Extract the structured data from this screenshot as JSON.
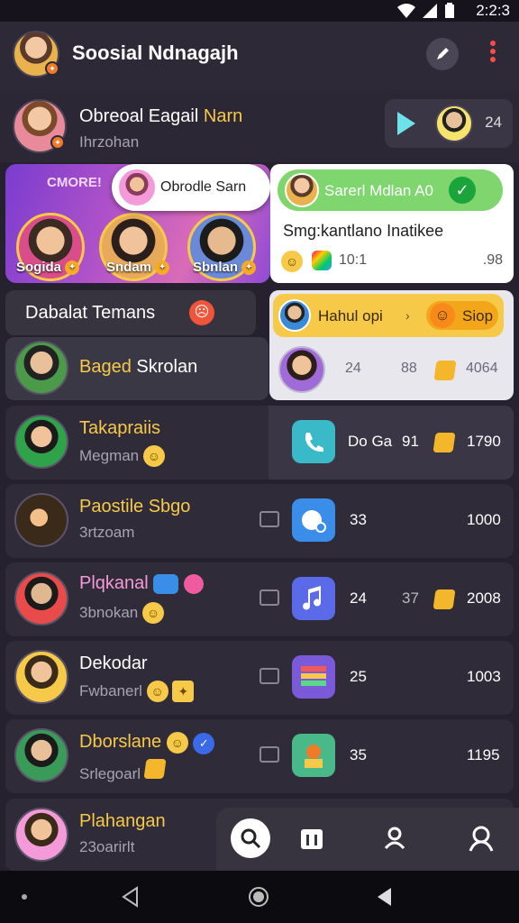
{
  "status_bar": {
    "time": "2:2:3"
  },
  "app_bar": {
    "title": "Soosial Ndnagajh"
  },
  "pinned": {
    "name_a": "Obreoal Eagail",
    "name_b": "Narn",
    "subtitle": "Ihrzohan",
    "count": "24"
  },
  "stories": {
    "label": "CMORE!",
    "items": [
      {
        "name": "Sogida"
      },
      {
        "name": "Sndam"
      },
      {
        "name": "Sbnlan"
      }
    ],
    "bubble_name": "Obrodle Sarn"
  },
  "notification": {
    "title": "Sarerl Mdlan A0",
    "text": "Smg:kantlano Inatikee",
    "count": "10:1",
    "time": ".98"
  },
  "section": {
    "title": "Dabalat Temans"
  },
  "highlight_card": {
    "name": "Hahul opi",
    "tag": "Siop",
    "stat1": "24",
    "stat2": "88",
    "stat3": "4064"
  },
  "rows": [
    {
      "name_a": "Baged",
      "name_b": "Skrolan",
      "subtitle": "",
      "v1": "",
      "v2": "",
      "v3": ""
    },
    {
      "name_a": "Takapraiis",
      "name_b": "",
      "subtitle": "Megman",
      "v1": "Do Ga",
      "v2": "91",
      "v3": "1790"
    },
    {
      "name_a": "Paostile Sbgo",
      "name_b": "",
      "subtitle": "3rtzoam",
      "v1": "33",
      "v2": "",
      "v3": "1000"
    },
    {
      "name_a": "Plqkanal",
      "name_b": "",
      "subtitle": "3bnokan",
      "v1": "24",
      "v2": "37",
      "v3": "2008"
    },
    {
      "name_a": "Dekodar",
      "name_b": "",
      "subtitle": "Fwbanerl",
      "v1": "25",
      "v2": "",
      "v3": "1003"
    },
    {
      "name_a": "Dborslane",
      "name_b": "",
      "subtitle": "Srlegoarl",
      "v1": "35",
      "v2": "",
      "v3": "1195"
    },
    {
      "name_a": "Plahangan",
      "name_b": "",
      "subtitle": "23oarirlt",
      "v1": "",
      "v2": "",
      "v3": ""
    }
  ],
  "colors": {
    "accent_yellow": "#f7c948",
    "pink": "#f59ad8",
    "bg": "#26212f"
  }
}
